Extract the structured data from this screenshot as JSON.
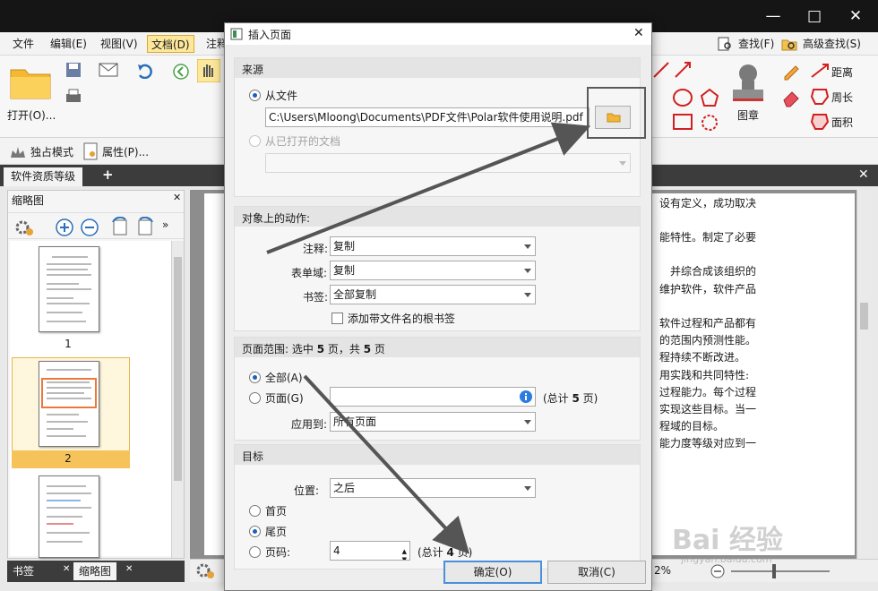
{
  "menu": {
    "items": [
      "文件",
      "编辑(E)",
      "视图(V)",
      "文档(D)",
      "注释"
    ],
    "active_index": 3,
    "search_label": "查找(F)",
    "adv_search_label": "高级查找(S)"
  },
  "ribbon": {
    "open_label": "打开(O)...",
    "stamp_label": "图章",
    "distance_label": "距离",
    "perimeter_label": "周长",
    "area_label": "面积"
  },
  "toolbar2": {
    "exclusive_label": "独占模式",
    "properties_label": "属性(P)..."
  },
  "doc_tab": {
    "label": "软件资质等级"
  },
  "thumb_panel": {
    "title": "缩略图",
    "pages": [
      "1",
      "2"
    ],
    "selected_page": "2"
  },
  "bottom_tabs": {
    "bookmarks": "书签",
    "thumbnails": "缩略图"
  },
  "doc_text": [
    "设有定义，成功取决",
    "能特性。制定了必要",
    "并综合成该组织的",
    "维护软件，软件产品",
    "软件过程和产品都有",
    "的范围内预测性能。",
    "程持续不断改进。",
    "用实践和共同特性:",
    "过程能力。每个过程",
    "实现这些目标。当一",
    "程域的目标。",
    "能力度等级对应到一"
  ],
  "status": {
    "zoom": "2%"
  },
  "dialog": {
    "title": "插入页面",
    "source": {
      "header": "来源",
      "from_file_label": "从文件",
      "file_path": "C:\\Users\\Mloong\\Documents\\PDF文件\\Polar软件使用说明.pdf",
      "from_open_label": "从已打开的文档"
    },
    "actions": {
      "header": "对象上的动作:",
      "annotations_label": "注释:",
      "annotations_value": "复制",
      "forms_label": "表单域:",
      "forms_value": "复制",
      "bookmarks_label": "书签:",
      "bookmarks_value": "全部复制",
      "add_root_bookmark_label": "添加带文件名的根书签"
    },
    "range": {
      "header_prefix": "页面范围: 选中 ",
      "selected": "5",
      "header_mid": " 页，共 ",
      "total": "5",
      "header_suffix": " 页",
      "all_label": "全部(A)",
      "pages_label": "页面(G)",
      "total_note_prefix": "(总计 ",
      "total_note_count": "5",
      "total_note_suffix": " 页)",
      "apply_to_label": "应用到:",
      "apply_to_value": "所有页面"
    },
    "target": {
      "header": "目标",
      "position_label": "位置:",
      "position_value": "之后",
      "first_page_label": "首页",
      "last_page_label": "尾页",
      "page_number_label": "页码:",
      "page_number_value": "4",
      "total_note_prefix": "(总计 ",
      "total_note_count": "4",
      "total_note_suffix": " 页)"
    },
    "ok_label": "确定(O)",
    "cancel_label": "取消(C)"
  },
  "watermark": {
    "text": "Bai 经验",
    "sub": "jingyan.baidu.com"
  },
  "colors": {
    "accent": "#1c5fb8",
    "active_menu": "#fde79a",
    "arrow": "#555555"
  }
}
